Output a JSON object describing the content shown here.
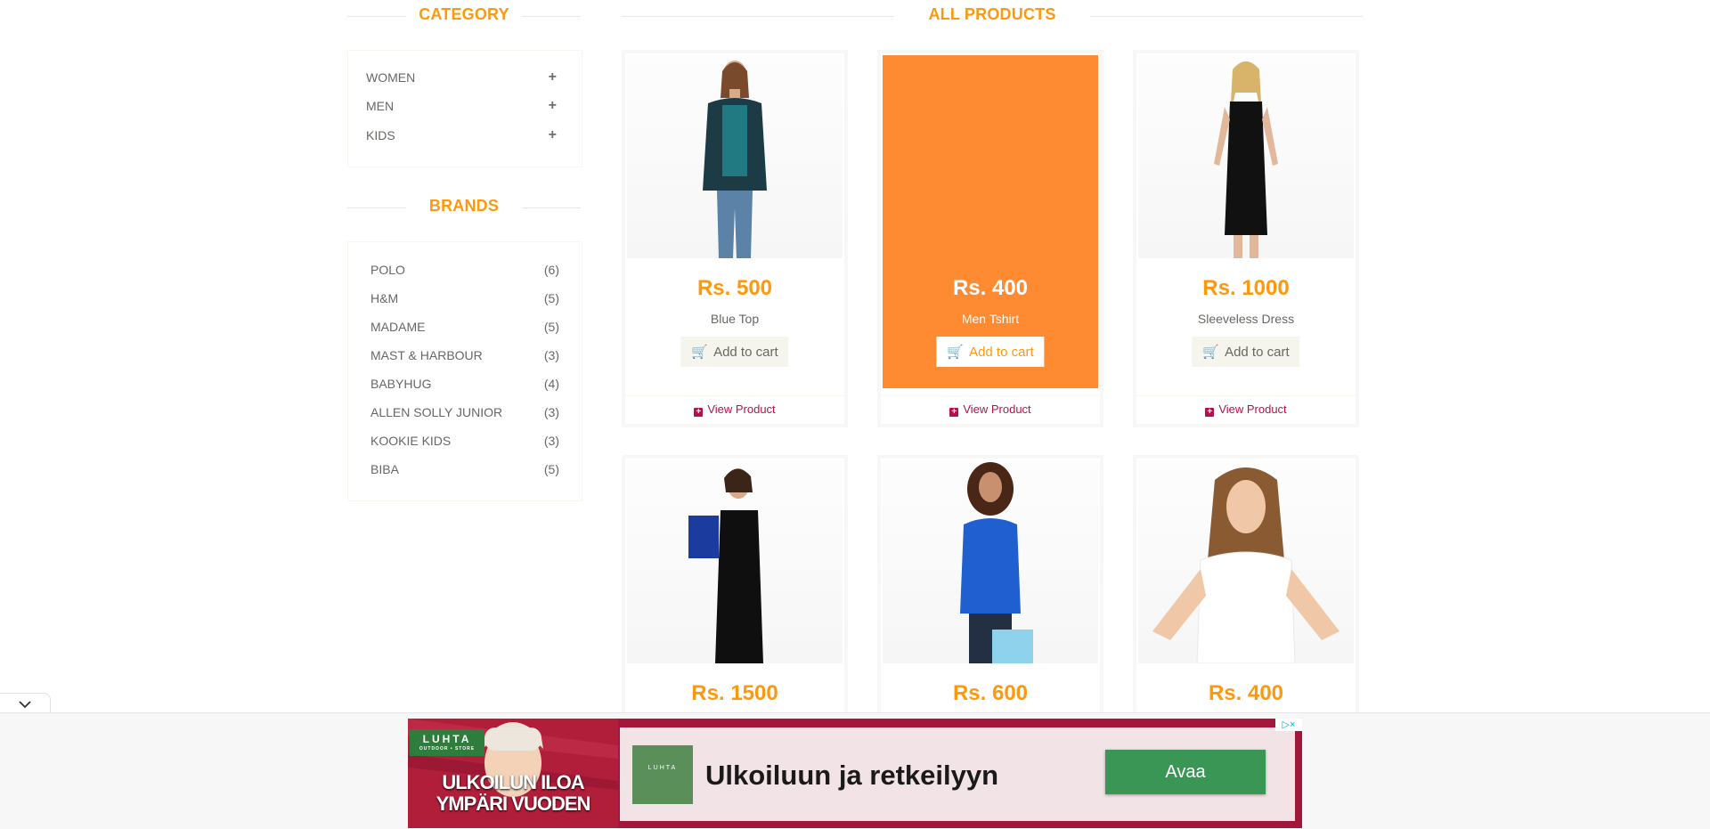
{
  "sidebar": {
    "category_title": "CATEGORY",
    "categories": [
      {
        "label": "WOMEN",
        "icon": "plus-icon"
      },
      {
        "label": "MEN",
        "icon": "plus-icon"
      },
      {
        "label": "KIDS",
        "icon": "plus-icon"
      }
    ],
    "brands_title": "BRANDS",
    "brands": [
      {
        "name": "POLO",
        "count": "(6)"
      },
      {
        "name": "H&M",
        "count": "(5)"
      },
      {
        "name": "MADAME",
        "count": "(5)"
      },
      {
        "name": "MAST & HARBOUR",
        "count": "(3)"
      },
      {
        "name": "BABYHUG",
        "count": "(4)"
      },
      {
        "name": "ALLEN SOLLY JUNIOR",
        "count": "(3)"
      },
      {
        "name": "KOOKIE KIDS",
        "count": "(3)"
      },
      {
        "name": "BIBA",
        "count": "(5)"
      }
    ]
  },
  "main": {
    "title": "ALL PRODUCTS",
    "products": [
      {
        "price": "Rs. 500",
        "name": "Blue Top",
        "cart_label": "Add to cart",
        "view_label": "View Product",
        "highlighted": false
      },
      {
        "price": "Rs. 400",
        "name": "Men Tshirt",
        "cart_label": "Add to cart",
        "view_label": "View Product",
        "highlighted": true
      },
      {
        "price": "Rs. 1000",
        "name": "Sleeveless Dress",
        "cart_label": "Add to cart",
        "view_label": "View Product",
        "highlighted": false
      },
      {
        "price": "Rs. 1500"
      },
      {
        "price": "Rs. 600"
      },
      {
        "price": "Rs. 400"
      }
    ]
  },
  "ad": {
    "brand": "LUHTA",
    "brand_sub": "OUTDOOR • STORE",
    "slogan_line1": "ULKOILUN ILOA",
    "slogan_line2": "YMPÄRI VUODEN",
    "headline": "Ulkoiluun ja retkeilyyn",
    "button_label": "Avaa",
    "adchoices": "▷×"
  },
  "colors": {
    "accent": "#FE980F",
    "highlight": "#FE8A32",
    "view_link": "#B3114D",
    "ad_red": "#A3173A",
    "ad_button": "#3A9655"
  }
}
